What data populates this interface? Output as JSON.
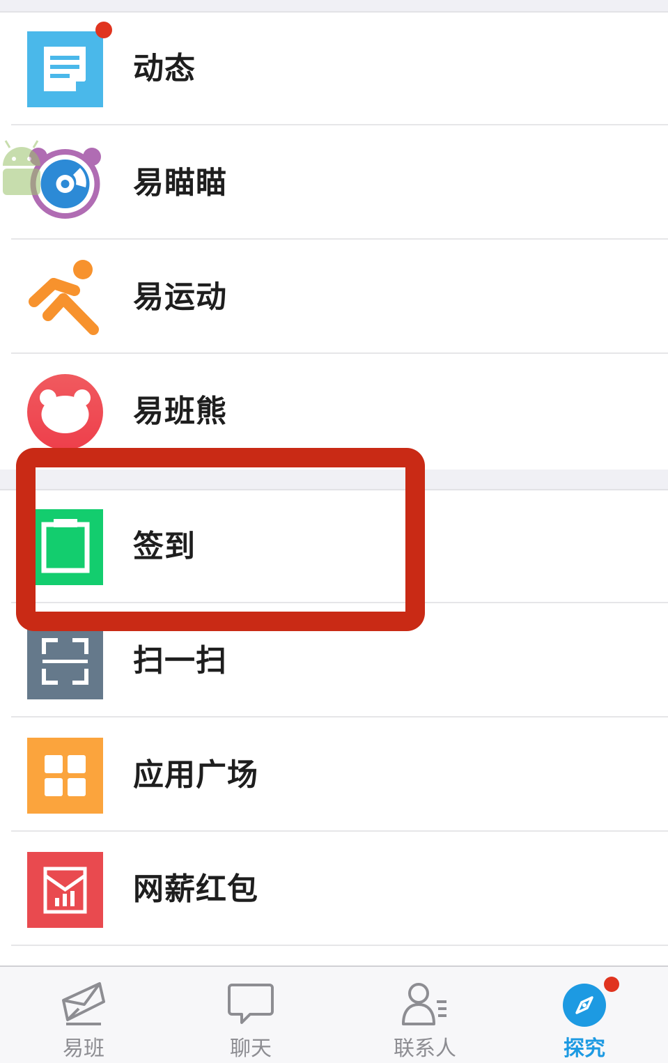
{
  "menu": {
    "group1": [
      {
        "label": "动态",
        "icon": "feed-doc-icon",
        "badge": true
      },
      {
        "label": "易瞄瞄",
        "icon": "eye-camera-icon",
        "badge": false
      },
      {
        "label": "易运动",
        "icon": "running-figure-icon",
        "badge": false
      },
      {
        "label": "易班熊",
        "icon": "bear-icon",
        "badge": false
      }
    ],
    "group2": [
      {
        "label": "签到",
        "icon": "checkin-pencil-icon"
      },
      {
        "label": "扫一扫",
        "icon": "scan-frame-icon"
      },
      {
        "label": "应用广场",
        "icon": "app-grid-icon"
      },
      {
        "label": "网薪红包",
        "icon": "red-envelope-chart-icon"
      }
    ]
  },
  "tabs": [
    {
      "label": "易班",
      "icon": "yiban-envelope-icon",
      "active": false
    },
    {
      "label": "聊天",
      "icon": "chat-bubble-icon",
      "active": false
    },
    {
      "label": "联系人",
      "icon": "contacts-person-icon",
      "active": false
    },
    {
      "label": "探究",
      "icon": "compass-icon",
      "active": true
    }
  ],
  "colors": {
    "highlight": "#c92a15",
    "accent": "#1d9ae2",
    "badge": "#e0341f"
  }
}
